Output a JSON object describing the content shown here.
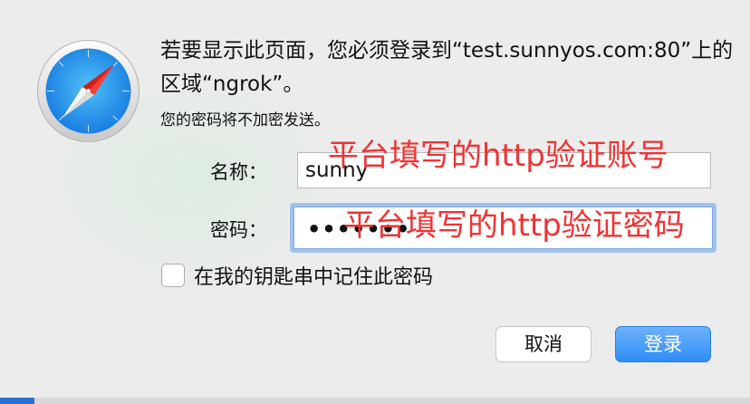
{
  "dialog": {
    "message": "若要显示此页面，您必须登录到“test.sunnyos.com:80”上的区域“ngrok”。",
    "info": "您的密码将不加密发送。"
  },
  "fields": {
    "name_label": "名称：",
    "name_value": "sunny",
    "password_label": "密码：",
    "password_value": "•••••••"
  },
  "remember": {
    "label": "在我的钥匙串中记住此密码",
    "checked": false
  },
  "buttons": {
    "cancel": "取消",
    "login": "登录"
  },
  "annotations": {
    "username_note": "平台填写的http验证账号",
    "password_note": "平台填写的http验证密码"
  },
  "icons": {
    "app": "safari-compass-icon"
  },
  "colors": {
    "accent": "#2f8cf8",
    "annotation": "#ee3333",
    "focus_ring": "#9fc1ec"
  }
}
